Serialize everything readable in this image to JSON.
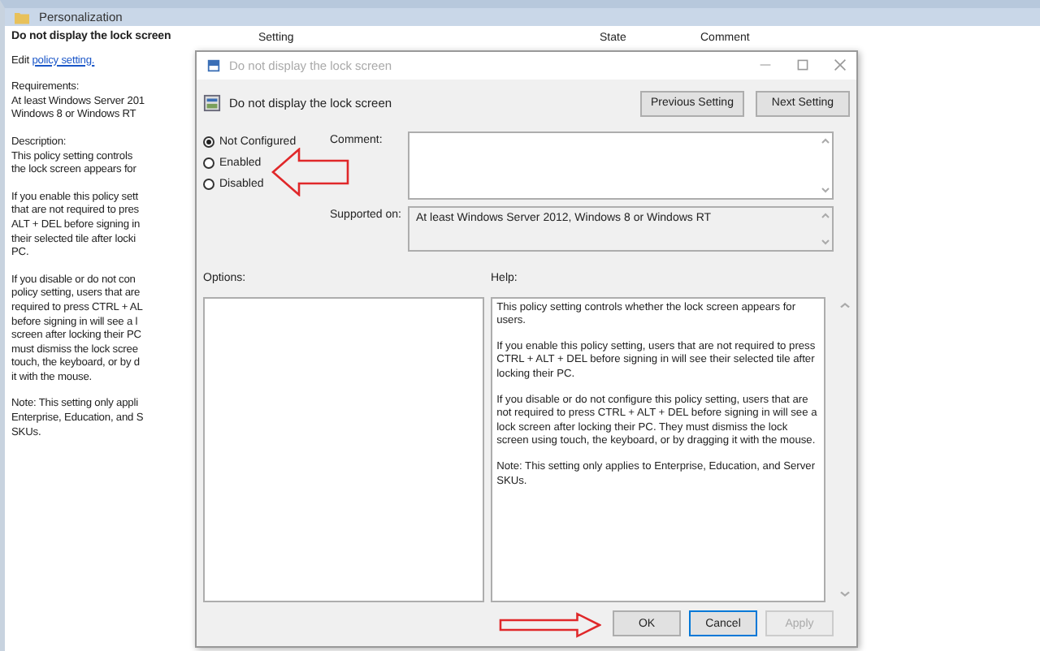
{
  "background_window": {
    "folder_title": "Personalization",
    "policy_name": "Do not display the lock screen",
    "edit_prefix": "Edit",
    "edit_link": "policy setting.",
    "columns": [
      "Setting",
      "State",
      "Comment"
    ],
    "description": [
      [
        "Requirements:",
        "At least Windows Server 201",
        "Windows 8 or Windows RT"
      ],
      [
        "Description:",
        "This policy setting controls",
        "the lock screen appears for"
      ],
      [
        "If you enable this policy sett",
        "that are not required to pres",
        "ALT + DEL before signing in",
        "their selected tile after locki",
        "PC."
      ],
      [
        "If you disable or do not con",
        "policy setting, users that are",
        "required to press CTRL + AL",
        "before signing in will see a l",
        "screen after locking their PC",
        "must dismiss the lock scree",
        "touch, the keyboard, or by d",
        "it with the mouse."
      ],
      [
        "Note: This setting only appli",
        "Enterprise, Education, and S",
        "SKUs."
      ]
    ]
  },
  "dialog": {
    "title": "Do not display the lock screen",
    "header": "Do not display the lock screen",
    "nav_buttons": [
      "Previous Setting",
      "Next Setting"
    ],
    "states": [
      {
        "label": "Not Configured",
        "selected": true
      },
      {
        "label": "Enabled",
        "selected": false
      },
      {
        "label": "Disabled",
        "selected": false
      }
    ],
    "comment_label": "Comment:",
    "supported_label": "Supported on:",
    "supported_text": "At least Windows Server 2012, Windows 8 or Windows RT",
    "options_label": "Options:",
    "help_label": "Help:",
    "help": [
      "This policy setting controls whether the lock screen appears for users.",
      "If you enable this policy setting, users that are not required to press CTRL + ALT + DEL before signing in will see their selected tile after locking their PC.",
      "If you disable or do not configure this policy setting, users that are not required to press CTRL + ALT + DEL before signing in will see a lock screen after locking their PC. They must dismiss the lock screen using touch, the keyboard, or by dragging it with the mouse.",
      "Note: This setting only applies to Enterprise, Education, and Server SKUs."
    ],
    "buttons": [
      {
        "label": "OK",
        "focused": false,
        "disabled": false
      },
      {
        "label": "Cancel",
        "focused": true,
        "disabled": false
      },
      {
        "label": "Apply",
        "focused": false,
        "disabled": true
      }
    ]
  }
}
